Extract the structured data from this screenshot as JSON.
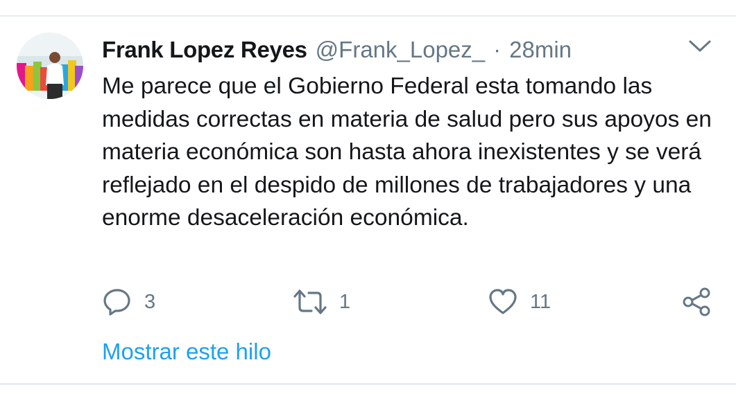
{
  "tweet": {
    "display_name": "Frank Lopez Reyes",
    "handle": "@Frank_Lopez_",
    "separator": "·",
    "time": "28min",
    "text": "Me parece que el Gobierno Federal esta tomando las medidas correctas en materia de salud pero sus apoyos en materia económica son hasta ahora inexistentes y se verá reflejado en el despido de millones de trabajadores y una enorme desaceleración económica.",
    "replies": "3",
    "retweets": "1",
    "likes": "11",
    "show_thread": "Mostrar este hilo"
  },
  "colors": {
    "text": "#14171a",
    "secondary": "#657786",
    "link": "#1da1f2",
    "divider": "#e6ecf0"
  },
  "icons": {
    "menu": "chevron-down-icon",
    "reply": "reply-icon",
    "retweet": "retweet-icon",
    "like": "heart-icon",
    "share": "share-icon"
  }
}
